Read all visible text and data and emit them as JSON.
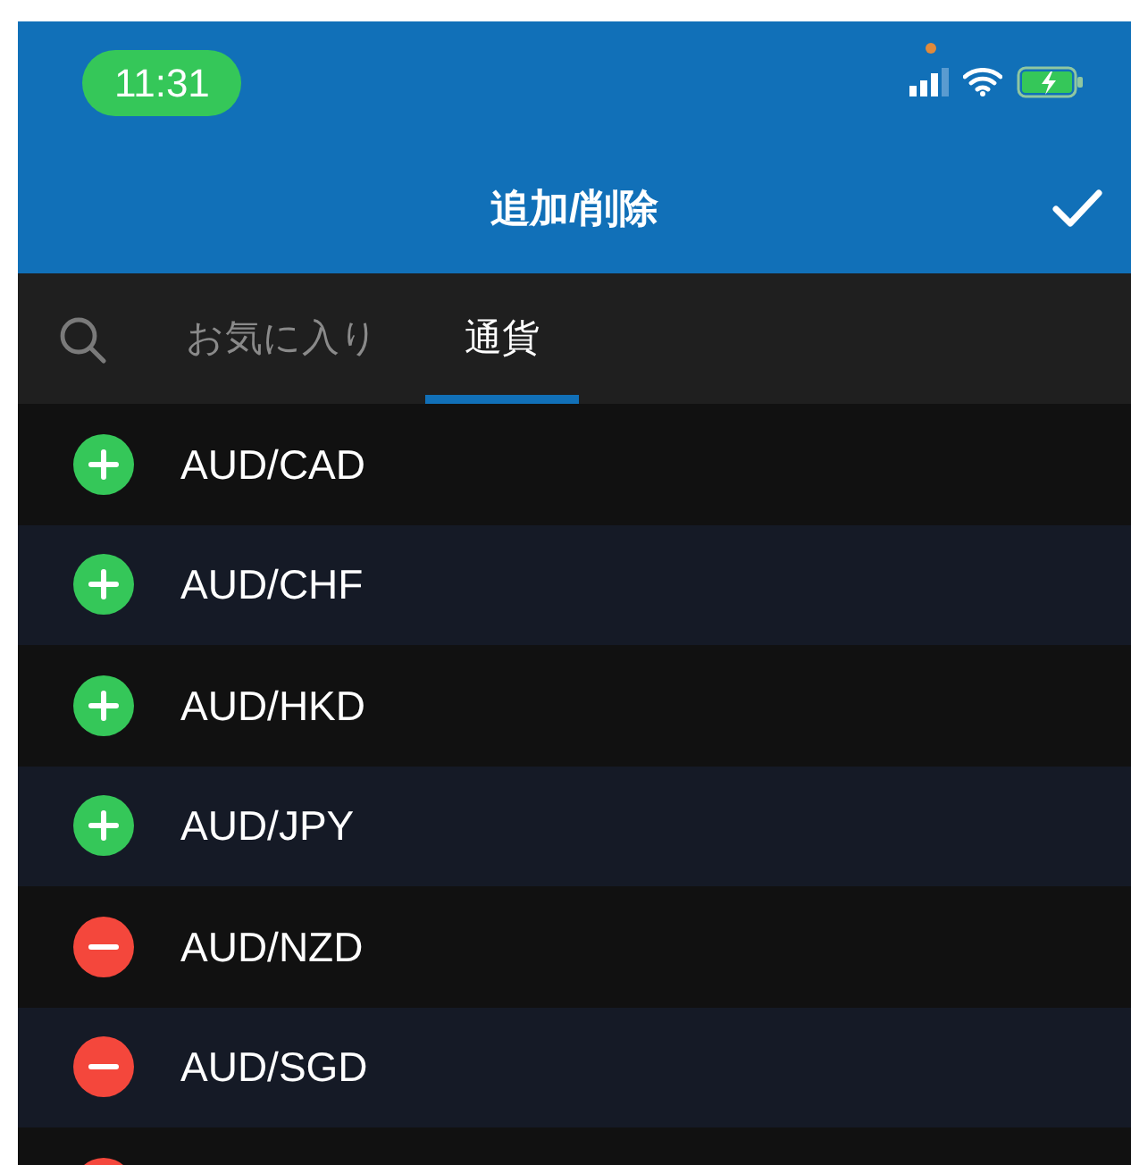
{
  "status_bar": {
    "time": "11:31"
  },
  "header": {
    "title": "追加/削除"
  },
  "tabs": [
    {
      "label": "お気に入り",
      "selected": false
    },
    {
      "label": "通貨",
      "selected": true
    }
  ],
  "rows": [
    {
      "name": "AUD/CAD",
      "kind": "add"
    },
    {
      "name": "AUD/CHF",
      "kind": "add"
    },
    {
      "name": "AUD/HKD",
      "kind": "add"
    },
    {
      "name": "AUD/JPY",
      "kind": "add"
    },
    {
      "name": "AUD/NZD",
      "kind": "remove"
    },
    {
      "name": "AUD/SGD",
      "kind": "remove"
    },
    {
      "kind": "remove"
    }
  ]
}
